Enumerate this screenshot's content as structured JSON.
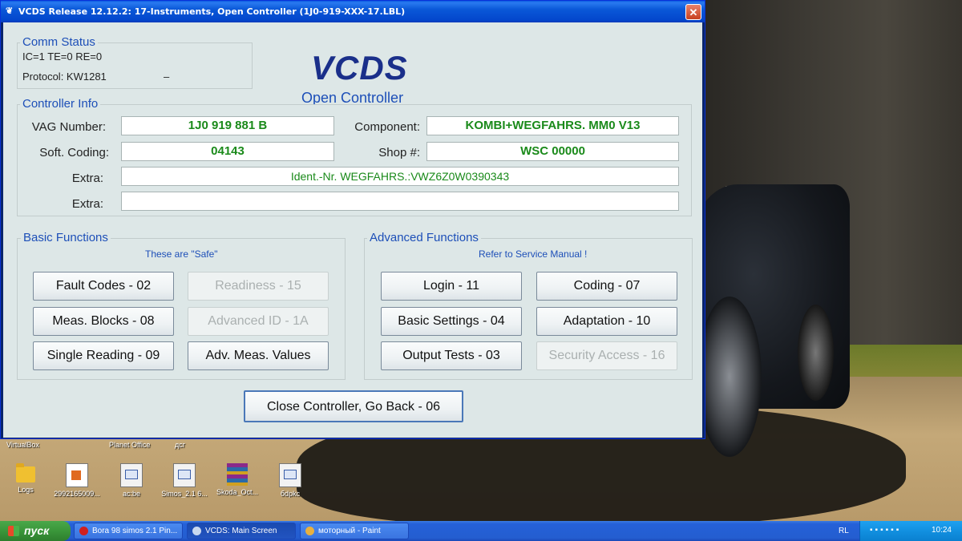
{
  "window": {
    "title": "VCDS Release 12.12.2: 17-Instruments,  Open Controller (1J0-919-XXX-17.LBL)",
    "close_glyph": "✕"
  },
  "comm_status": {
    "title": "Comm Status",
    "ic_te_re": "IC=1  TE=0   RE=0",
    "protocol": "Protocol: KW1281",
    "protocol_indicator": "–"
  },
  "logo": {
    "title": "VCDS",
    "subtitle": "Open Controller"
  },
  "controller_info": {
    "title": "Controller Info",
    "vag_label": "VAG Number:",
    "vag_value": "1J0 919 881 B",
    "component_label": "Component:",
    "component_value": "KOMBI+WEGFAHRS. MM0 V13",
    "coding_label": "Soft. Coding:",
    "coding_value": "04143",
    "shop_label": "Shop #:",
    "shop_value": "WSC 00000",
    "extra1_label": "Extra:",
    "extra1_value": "Ident.-Nr. WEGFAHRS.:VWZ6Z0W0390343",
    "extra2_label": "Extra:",
    "extra2_value": ""
  },
  "basic": {
    "title": "Basic Functions",
    "note": "These are \"Safe\"",
    "fault_codes": "Fault Codes - 02",
    "readiness": "Readiness - 15",
    "meas_blocks": "Meas. Blocks - 08",
    "advanced_id": "Advanced ID - 1A",
    "single_reading": "Single Reading - 09",
    "adv_meas": "Adv. Meas. Values"
  },
  "advanced": {
    "title": "Advanced Functions",
    "note": "Refer to Service Manual !",
    "login": "Login - 11",
    "coding": "Coding - 07",
    "basic_settings": "Basic Settings - 04",
    "adaptation": "Adaptation - 10",
    "output_tests": "Output Tests - 03",
    "security_access": "Security Access - 16"
  },
  "close_controller": "Close Controller, Go Back - 06",
  "desktop": {
    "labels": [
      "VirtualBox",
      "Planet Office",
      "дсг"
    ],
    "icons": [
      "Logs",
      "2992165009...",
      "ac:be",
      "Simos_2.1 6...",
      "Skoda_Oct...",
      "бdpkc"
    ]
  },
  "taskbar": {
    "start": "пуск",
    "tasks": [
      "Bora 98 simos 2.1 Pin...",
      "VCDS:  Main Screen",
      "моторный - Paint"
    ],
    "lang": "RL",
    "clock": "10:24"
  },
  "colors": {
    "accent_blue": "#1d4fb8",
    "value_green": "#1a8a1a",
    "logo_navy": "#1a2f8a"
  }
}
